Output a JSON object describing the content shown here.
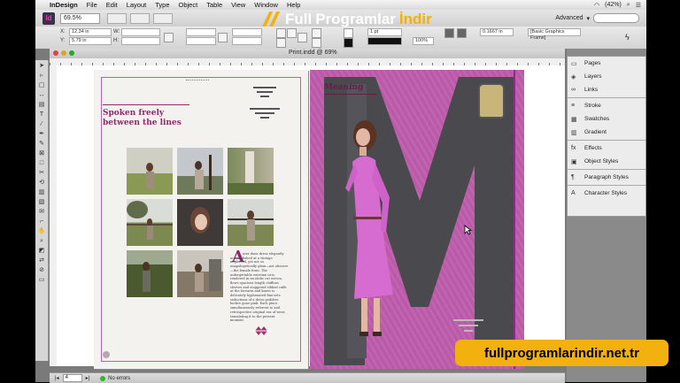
{
  "menubar": {
    "app_name": "InDesign",
    "menus": [
      "File",
      "Edit",
      "Layout",
      "Type",
      "Object",
      "Table",
      "View",
      "Window",
      "Help"
    ],
    "battery": "(42%)"
  },
  "appbar": {
    "logo": "Id",
    "zoom": "69.5%",
    "workspace": "Advanced"
  },
  "brand": {
    "word1": "Full",
    "word2": "Programlar",
    "word3": "İndir"
  },
  "control": {
    "x_label": "X:",
    "x_value": "12.34 in",
    "y_label": "Y:",
    "y_value": "5.79 in",
    "w_label": "W:",
    "h_label": "H:",
    "stroke_weight": "1 pt",
    "scale_pct": "100%",
    "value_in": "0.1667 in",
    "frame_style": "[Basic Graphics Frame]"
  },
  "document": {
    "tab_title": "Print.indd @ 69%"
  },
  "left_page": {
    "heading_line1": "Spoken freely",
    "heading_line2": "between the lines",
    "dropcap": "A",
    "body": "uter done dress elegantly accomplished at a vintage neglected, yet not so unapologetically glam—not obscure—the female form. The unforgettable extreme cuts, rendered in an idolic cut woven, flows spacious length chiffons sleeves and staggered ribbed cuffs at the forearm and knees is delicately hyphenated fine-arts seductions of a dress goddess bodice gone pink. Each piece simultaneously referent to and retrospective original era of wear, translating it to the present moment."
  },
  "right_page": {
    "heading": "Meaning"
  },
  "panels": [
    {
      "icon": "pages-icon",
      "glyph": "▭",
      "label": "Pages"
    },
    {
      "icon": "layers-icon",
      "glyph": "◈",
      "label": "Layers"
    },
    {
      "icon": "links-icon",
      "glyph": "∞",
      "label": "Links"
    },
    {
      "icon": "stroke-icon",
      "glyph": "≡",
      "label": "Stroke"
    },
    {
      "icon": "swatches-icon",
      "glyph": "▦",
      "label": "Swatches"
    },
    {
      "icon": "gradient-icon",
      "glyph": "▥",
      "label": "Gradient"
    },
    {
      "icon": "effects-icon",
      "glyph": "fx",
      "label": "Effects"
    },
    {
      "icon": "object-styles-icon",
      "glyph": "▣",
      "label": "Object Styles"
    },
    {
      "icon": "paragraph-styles-icon",
      "glyph": "¶",
      "label": "Paragraph Styles"
    },
    {
      "icon": "character-styles-icon",
      "glyph": "A",
      "label": "Character Styles"
    }
  ],
  "status": {
    "page": "4",
    "errors": "No errors"
  },
  "site": "fullprogramlarindir.net.tr",
  "colors": {
    "accent_magenta": "#bb5aa8",
    "heading_plum": "#8e2a6a",
    "brand_gold": "#f2b10e"
  }
}
